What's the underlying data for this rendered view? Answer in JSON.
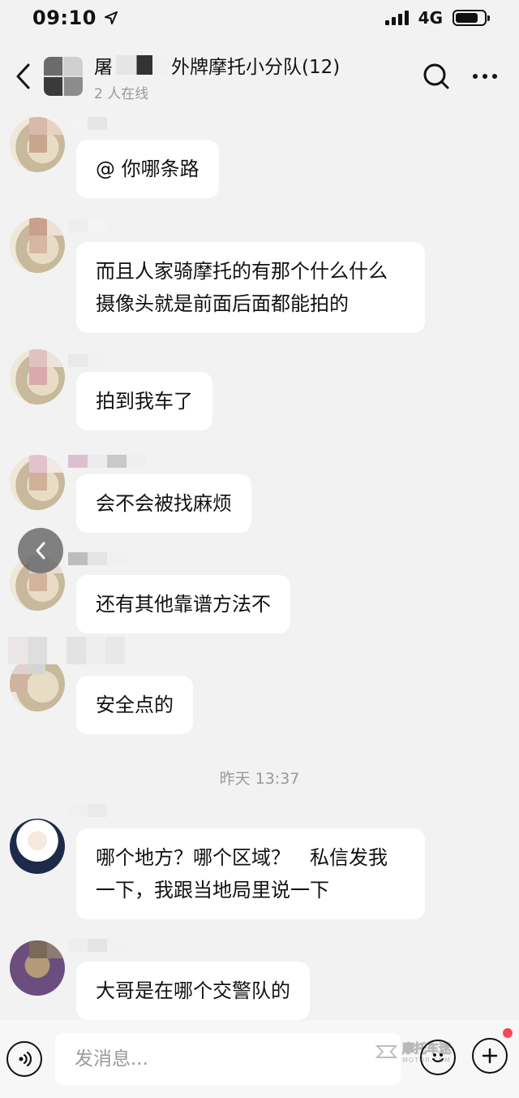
{
  "status_bar": {
    "time": "09:10",
    "network": "4G",
    "battery_level": 0.8
  },
  "header": {
    "title_prefix": "屠",
    "title_suffix": "外牌摩托小分队(12)",
    "online_status": "2 人在线",
    "icons": [
      "back-icon",
      "search-icon",
      "more-icon"
    ]
  },
  "messages": [
    {
      "text": "@ 你哪条路"
    },
    {
      "text": "而且人家骑摩托的有那个什么什么摄像头就是前面后面都能拍的"
    },
    {
      "text": "拍到我车了"
    },
    {
      "text": "会不会被找麻烦"
    },
    {
      "text": "还有其他靠谱方法不"
    },
    {
      "text": "安全点的"
    },
    {
      "text": "哪个地方？哪个区域？　私信发我一下，我跟当地局里说一下"
    },
    {
      "text": "大哥是在哪个交警队的"
    }
  ],
  "time_divider": "昨天 13:37",
  "input_bar": {
    "placeholder": "发消息..."
  },
  "watermark": {
    "main": "摩托车迷",
    "sub": "MOTOR.COM"
  },
  "colors": {
    "background": "#f2f2f2",
    "bubble": "#ffffff",
    "secondary_text": "#999999",
    "notification_dot": "#f24957"
  }
}
